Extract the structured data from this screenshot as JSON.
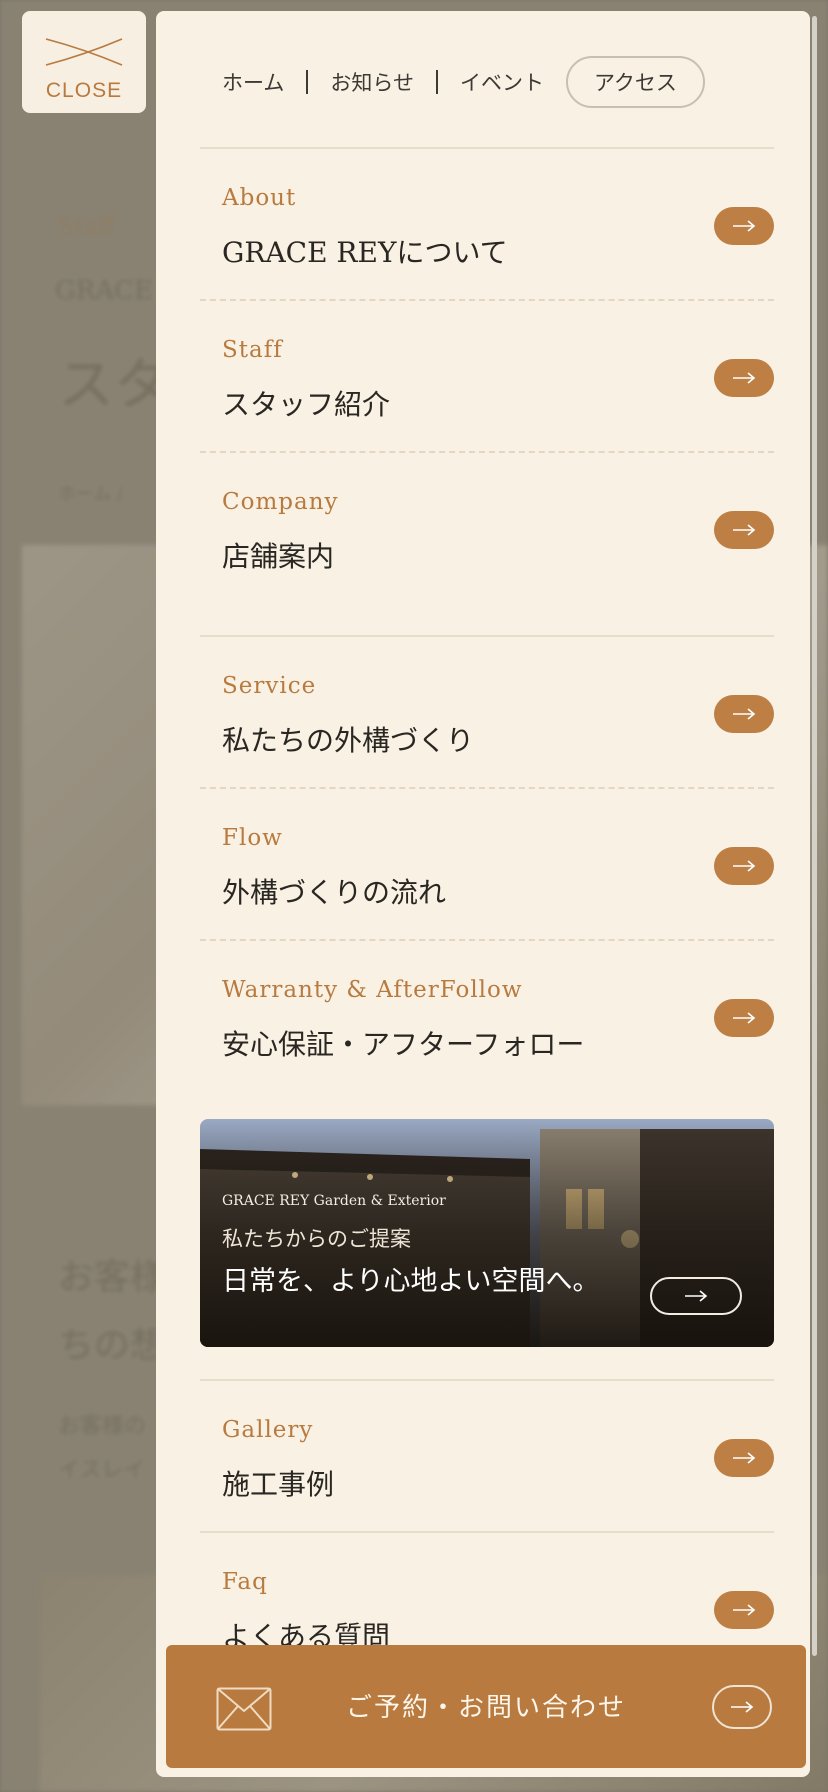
{
  "background_page": {
    "eyebrow": "Staff",
    "subtitle": "GRACE",
    "title": "スタ",
    "breadcrumb": "ホーム /",
    "heading_1": "お客様",
    "heading_2": "ちの想",
    "body_1": "お客様の",
    "body_2": "イスレイ"
  },
  "close_button": {
    "label": "CLOSE"
  },
  "top_nav": {
    "items": [
      {
        "label": "ホーム"
      },
      {
        "label": "お知らせ"
      },
      {
        "label": "イベント"
      }
    ],
    "access_label": "アクセス"
  },
  "menu": {
    "group1": [
      {
        "en": "About",
        "jp": "GRACE REYについて"
      },
      {
        "en": "Staff",
        "jp": "スタッフ紹介"
      },
      {
        "en": "Company",
        "jp": "店舗案内"
      }
    ],
    "group2": [
      {
        "en": "Service",
        "jp": "私たちの外構づくり"
      },
      {
        "en": "Flow",
        "jp": "外構づくりの流れ"
      },
      {
        "en": "Warranty & AfterFollow",
        "jp": "安心保証・アフターフォロー"
      }
    ],
    "group3": [
      {
        "en": "Gallery",
        "jp": "施工事例"
      },
      {
        "en": "Faq",
        "jp": "よくある質問"
      }
    ]
  },
  "banner": {
    "small": "GRACE REY Garden & Exterior",
    "mid": "私たちからのご提案",
    "large": "日常を、より心地よい空間へ。"
  },
  "contact": {
    "label": "ご予約・お問い合わせ"
  },
  "colors": {
    "accent": "#bd7f44",
    "panel": "#f8f1e4",
    "text": "#2a2723"
  },
  "icons": [
    "close-x-icon",
    "arrow-right-icon",
    "mail-icon"
  ]
}
